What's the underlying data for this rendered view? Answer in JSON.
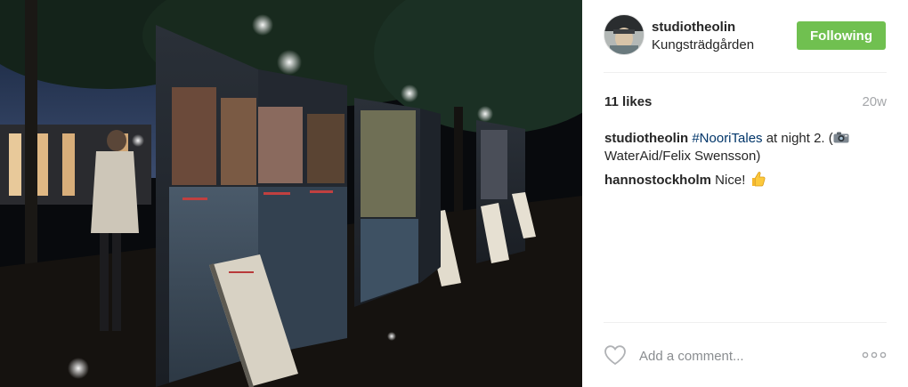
{
  "post": {
    "photo_alt": "Photo exhibition panels at night in a park",
    "author": {
      "username": "studiotheolin",
      "location": "Kungsträdgården"
    },
    "follow_button_label": "Following",
    "likes": "11 likes",
    "age": "20w",
    "comments": [
      {
        "author": "studiotheolin",
        "text_before": " ",
        "hashtag": "#NooriTales",
        "text_after_hashtag": " at night 2. (",
        "icon": "camera-emoji",
        "text_after_icon": " WaterAid/Felix Swensson)"
      },
      {
        "author": "hannostockholm",
        "text": " Nice! ",
        "icon": "thumbs-up-emoji"
      }
    ],
    "add_comment_placeholder": "Add a comment...",
    "icons": {
      "like": "heart-outline-icon",
      "more": "more-options-icon"
    }
  },
  "colors": {
    "follow_button": "#70c050",
    "hashtag": "#003569",
    "secondary_text": "#a5a7aa"
  }
}
